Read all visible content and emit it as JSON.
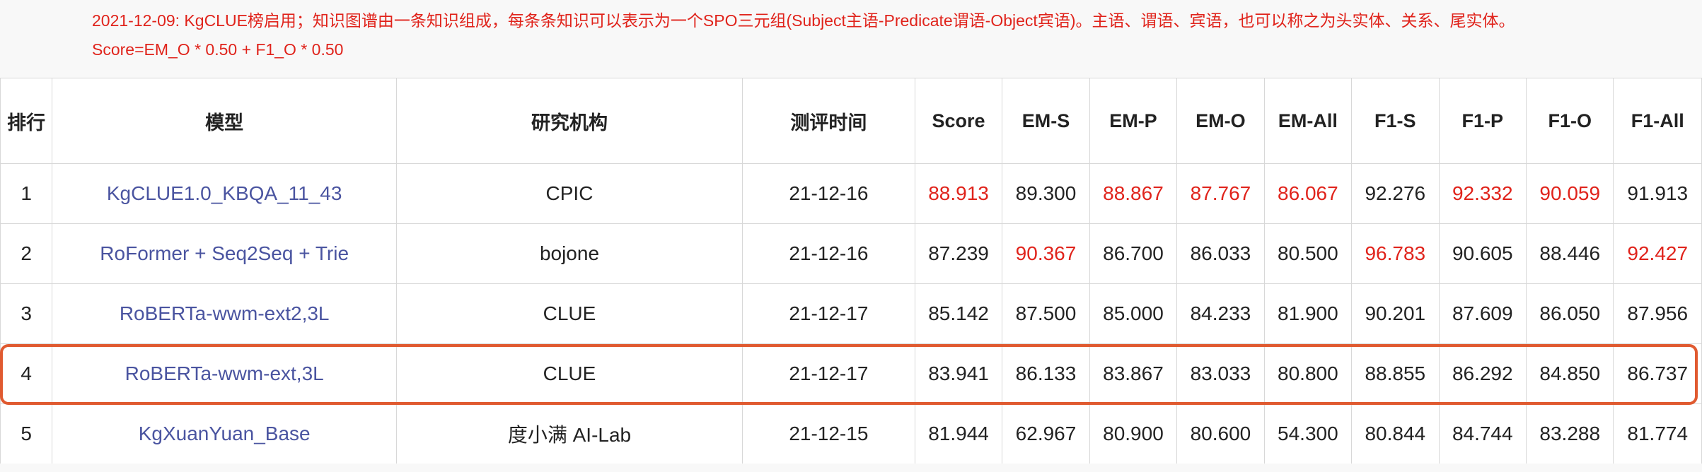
{
  "notice": {
    "line1": "2021-12-09: KgCLUE榜启用；知识图谱由一条知识组成，每条条知识可以表示为一个SPO三元组(Subject主语-Predicate谓语-Object宾语)。主语、谓语、宾语，也可以称之为头实体、关系、尾实体。",
    "line2": "Score=EM_O * 0.50 + F1_O * 0.50"
  },
  "colors": {
    "best_value": "#e0231b",
    "model_link": "#4a54a0",
    "highlight_border": "#e05a30"
  },
  "columns": [
    "排行",
    "模型",
    "研究机构",
    "测评时间",
    "Score",
    "EM-S",
    "EM-P",
    "EM-O",
    "EM-All",
    "F1-S",
    "F1-P",
    "F1-O",
    "F1-All"
  ],
  "rows": [
    {
      "cells": [
        "1",
        "KgCLUE1.0_KBQA_11_43",
        "CPIC",
        "21-12-16",
        "88.913",
        "89.300",
        "88.867",
        "87.767",
        "86.067",
        "92.276",
        "92.332",
        "90.059",
        "91.913"
      ],
      "best": [
        false,
        false,
        false,
        false,
        true,
        false,
        true,
        true,
        true,
        false,
        true,
        true,
        false
      ]
    },
    {
      "cells": [
        "2",
        "RoFormer + Seq2Seq + Trie",
        "bojone",
        "21-12-16",
        "87.239",
        "90.367",
        "86.700",
        "86.033",
        "80.500",
        "96.783",
        "90.605",
        "88.446",
        "92.427"
      ],
      "best": [
        false,
        false,
        false,
        false,
        false,
        true,
        false,
        false,
        false,
        true,
        false,
        false,
        true
      ]
    },
    {
      "cells": [
        "3",
        "RoBERTa-wwm-ext2,3L",
        "CLUE",
        "21-12-17",
        "85.142",
        "87.500",
        "85.000",
        "84.233",
        "81.900",
        "90.201",
        "87.609",
        "86.050",
        "87.956"
      ],
      "best": [
        false,
        false,
        false,
        false,
        false,
        false,
        false,
        false,
        false,
        false,
        false,
        false,
        false
      ]
    },
    {
      "cells": [
        "4",
        "RoBERTa-wwm-ext,3L",
        "CLUE",
        "21-12-17",
        "83.941",
        "86.133",
        "83.867",
        "83.033",
        "80.800",
        "88.855",
        "86.292",
        "84.850",
        "86.737"
      ],
      "best": [
        false,
        false,
        false,
        false,
        false,
        false,
        false,
        false,
        false,
        false,
        false,
        false,
        false
      ],
      "highlighted": true
    },
    {
      "cells": [
        "5",
        "KgXuanYuan_Base",
        "度小满 AI-Lab",
        "21-12-15",
        "81.944",
        "62.967",
        "80.900",
        "80.600",
        "54.300",
        "80.844",
        "84.744",
        "83.288",
        "81.774"
      ],
      "best": [
        false,
        false,
        false,
        false,
        false,
        false,
        false,
        false,
        false,
        false,
        false,
        false,
        false
      ]
    }
  ]
}
